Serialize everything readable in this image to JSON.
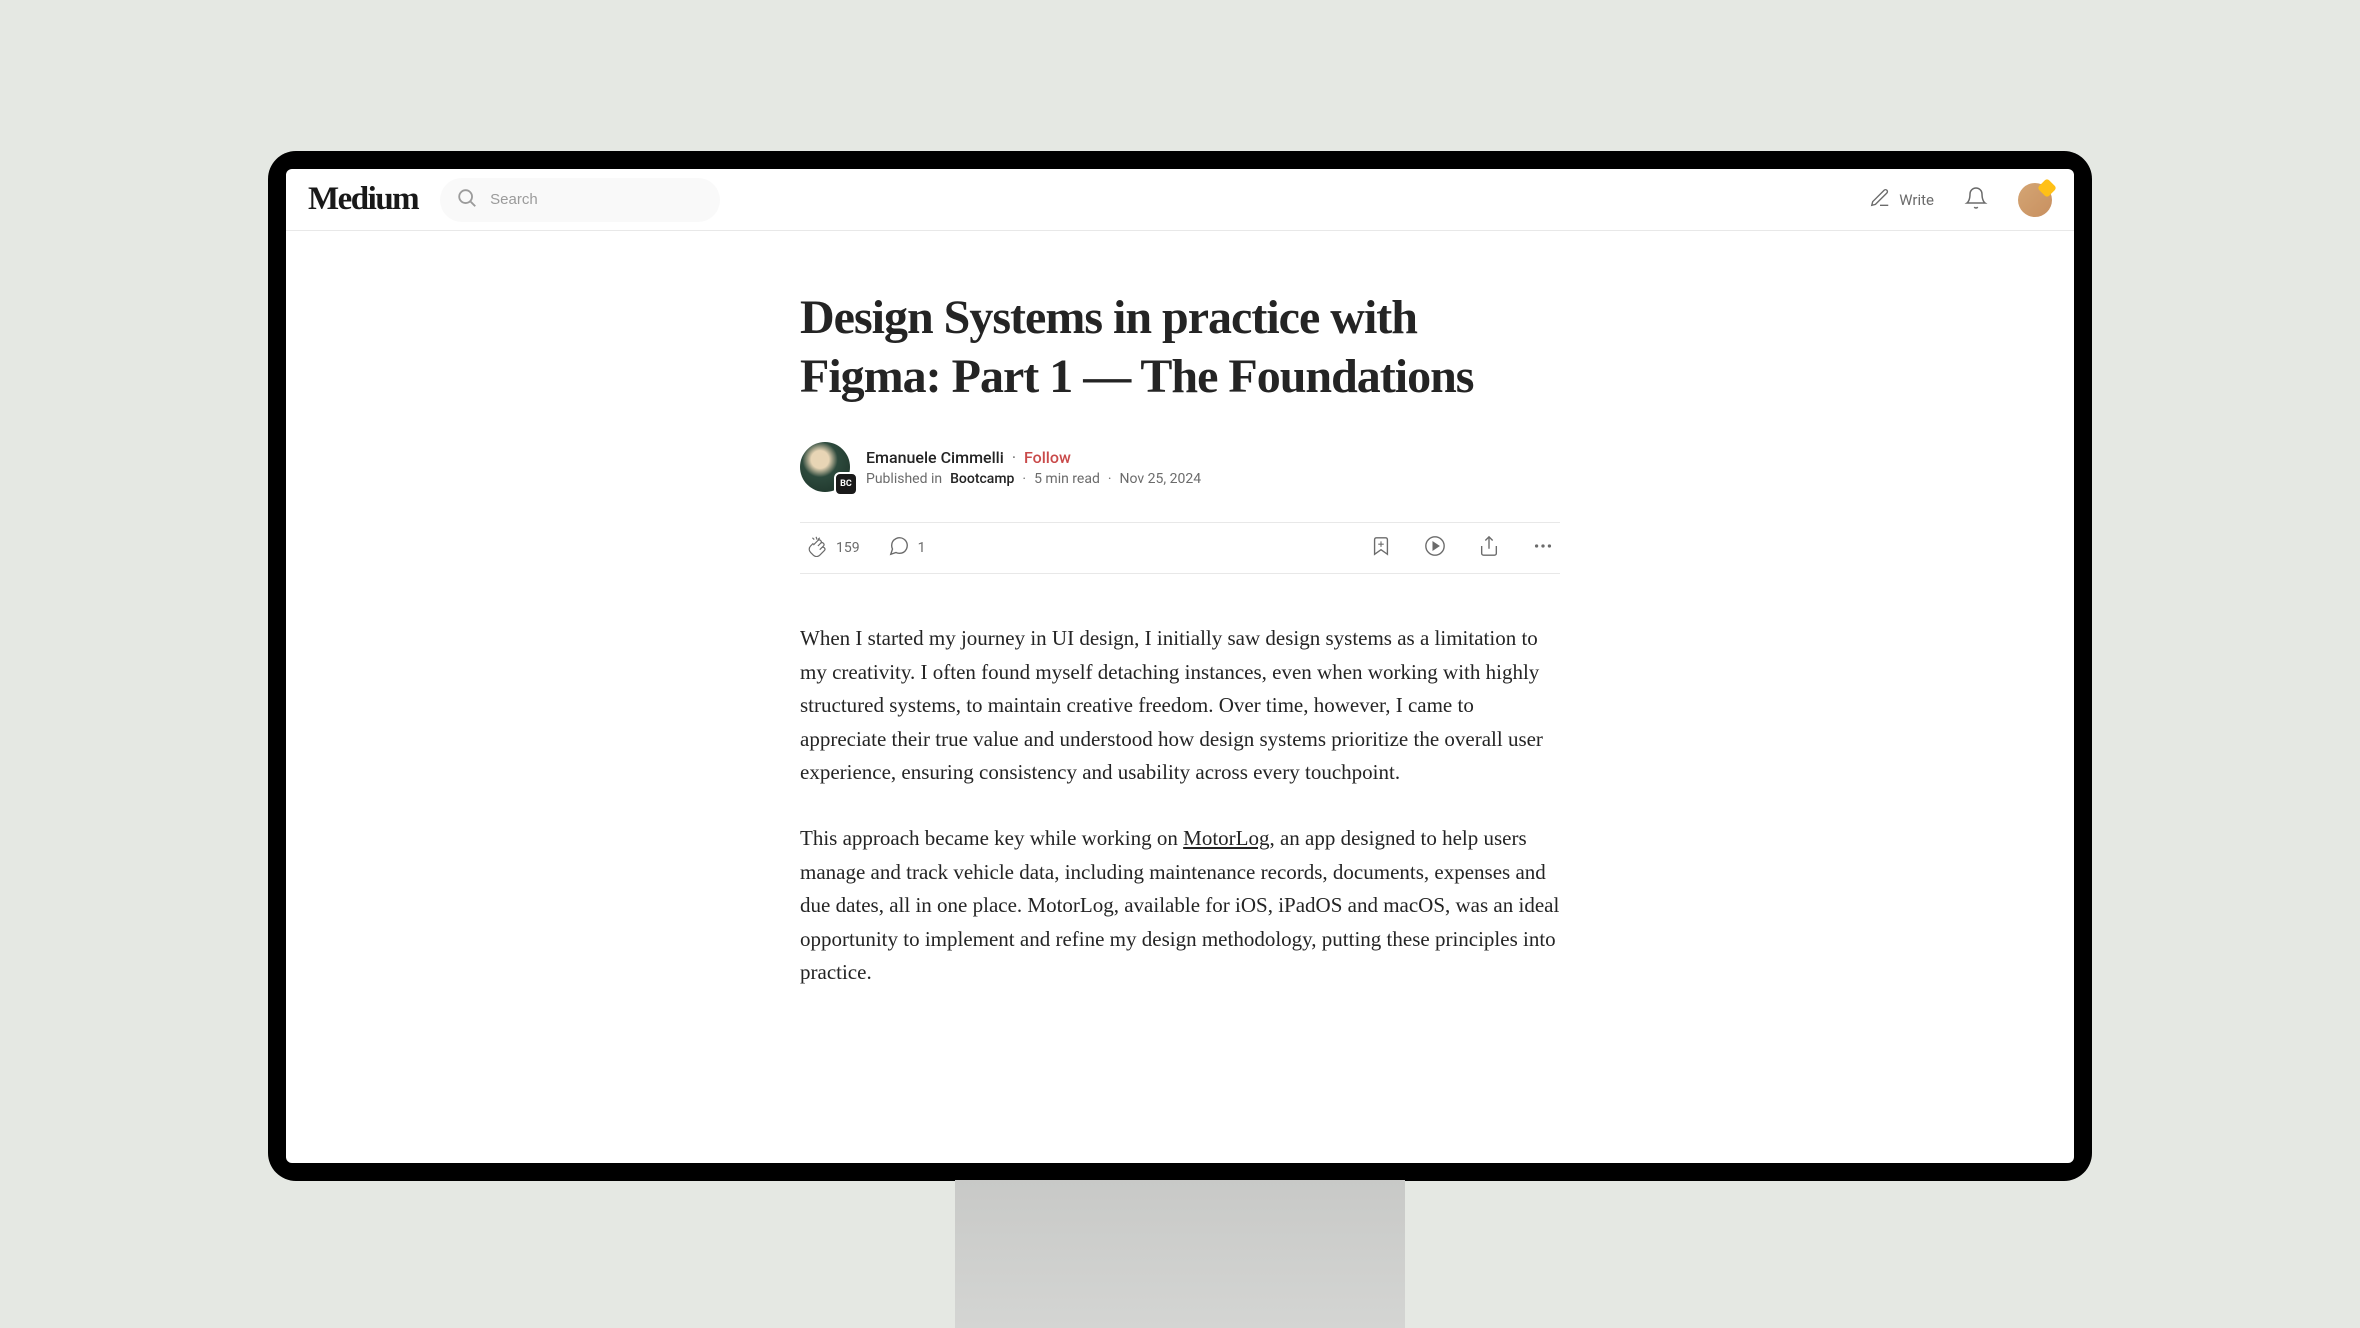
{
  "header": {
    "logo": "Medium",
    "search_placeholder": "Search",
    "write_label": "Write"
  },
  "article": {
    "title": "Design Systems in practice with Figma: Part 1 — The Foundations",
    "author": "Emanuele Cimmelli",
    "follow_label": "Follow",
    "published_in_prefix": "Published in",
    "publication": "Bootcamp",
    "publication_badge": "BC",
    "read_time": "5 min read",
    "date": "Nov 25, 2024",
    "claps": "159",
    "comments": "1",
    "paragraph1": "When I started my journey in UI design, I initially saw design systems as a limitation to my creativity. I often found myself detaching instances, even when working with highly structured systems, to maintain creative freedom. Over time, however, I came to appreciate their true value and understood how design systems prioritize the overall user experience, ensuring consistency and usability across every touchpoint.",
    "paragraph2_pre": "This approach became key while working on ",
    "paragraph2_link": "MotorLog",
    "paragraph2_post": ", an app designed to help users manage and track vehicle data, including maintenance records, documents, expenses and due dates, all in one place. MotorLog, available for iOS, iPadOS and macOS, was an ideal opportunity to implement and refine my design methodology, putting these principles into practice."
  }
}
